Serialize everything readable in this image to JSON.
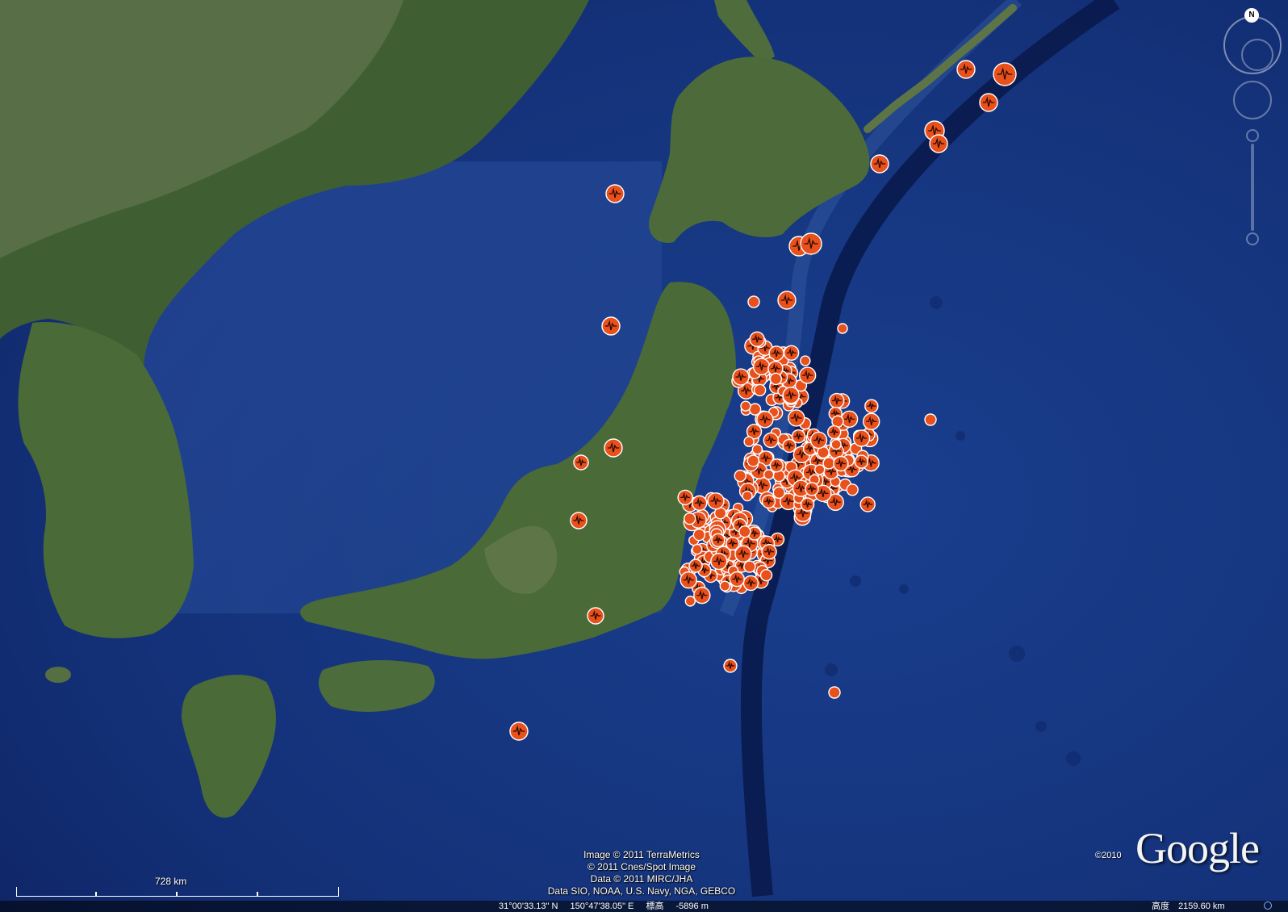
{
  "map": {
    "imagery_credits": [
      "Image © 2011 TerraMetrics",
      "© 2011 Cnes/Spot Image",
      "Data © 2011 MIRC/JHA",
      "Data SIO, NOAA, U.S. Navy, NGA, GEBCO"
    ],
    "copyright_year": "©2010",
    "logo": "Google",
    "scale_label": "728 km",
    "marker_color": "#e8501c",
    "marker_icon": "earthquake-waveform-icon"
  },
  "compass": {
    "north_label": "N"
  },
  "status": {
    "latitude": "31°00'33.13\" N",
    "longitude": "150°47'38.05\" E",
    "elevation_label": "標高",
    "elevation_value": "-5896 m",
    "altitude_label": "高度",
    "altitude_value": "2159.60 km"
  }
}
